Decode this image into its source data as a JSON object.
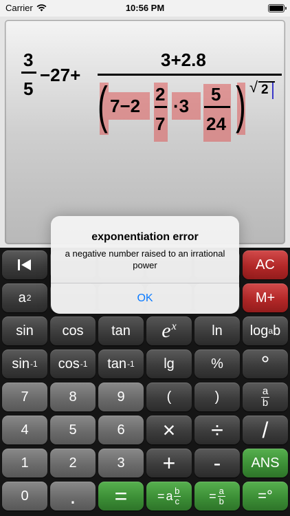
{
  "status_bar": {
    "carrier": "Carrier",
    "time": "10:56 PM"
  },
  "expression": {
    "term1_numerator": "3",
    "term1_denominator": "5",
    "middle": "−27+",
    "main_numerator": "3+2.8",
    "base_prefix": "7−2",
    "mixed1_numerator": "2",
    "mixed1_denominator": "7",
    "operator_dot": "·3",
    "mixed2_numerator": "5",
    "mixed2_denominator": "24",
    "root_sign": "√",
    "root_value": "2",
    "left_paren": "(",
    "right_paren": ")"
  },
  "keys": {
    "back": "|◀",
    "ac": "AC",
    "a_squared_base": "a",
    "a_squared_exp": "2",
    "m_plus": "M+",
    "sin": "sin",
    "cos": "cos",
    "tan": "tan",
    "exp_base": "e",
    "exp_power": "x",
    "ln": "ln",
    "log_base": "log",
    "log_sub": "a",
    "log_arg": "b",
    "sin_inv": "sin",
    "cos_inv": "cos",
    "tan_inv": "tan",
    "inv_exp": "-1",
    "lg": "lg",
    "percent": "%",
    "degree": "°",
    "seven": "7",
    "eight": "8",
    "nine": "9",
    "open_paren": "(",
    "close_paren": ")",
    "frac_a": "a",
    "frac_b": "b",
    "four": "4",
    "five": "5",
    "six": "6",
    "multiply": "×",
    "divide": "÷",
    "slash": "/",
    "one": "1",
    "two": "2",
    "three": "3",
    "plus": "+",
    "minus": "-",
    "ans": "ANS",
    "zero": "0",
    "point": ".",
    "equals": "=",
    "eq_mixed_prefix": "=",
    "eq_mixed_a": "a",
    "eq_mixed_b": "b",
    "eq_mixed_c": "c",
    "eq_frac_prefix": "=",
    "eq_frac_a": "a",
    "eq_frac_b": "b",
    "eq_deg": "=°"
  },
  "alert": {
    "title": "exponentiation error",
    "message": "a negative number raised to an irrational power",
    "ok_label": "OK"
  },
  "colors": {
    "accent_blue": "#0a7aff",
    "ac_red": "#b32828",
    "equals_green": "#3c8f36",
    "highlight": "#dc5a5a",
    "cursor": "#3a37c8"
  }
}
